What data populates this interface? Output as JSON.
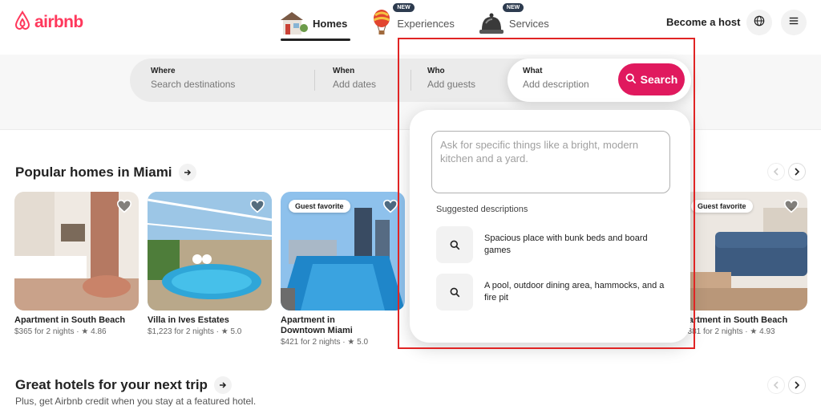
{
  "brand": {
    "name": "airbnb",
    "color": "#ff385c",
    "icon": "airbnb-logo-icon"
  },
  "nav": [
    {
      "label": "Homes",
      "icon": "house-icon",
      "active": true,
      "badge": ""
    },
    {
      "label": "Experiences",
      "icon": "hot-air-balloon-icon",
      "active": false,
      "badge": "NEW"
    },
    {
      "label": "Services",
      "icon": "service-bell-icon",
      "active": false,
      "badge": "NEW"
    }
  ],
  "header": {
    "host_label": "Become a host",
    "globe_icon": "globe-icon",
    "menu_icon": "menu-icon"
  },
  "search": {
    "where": {
      "label": "Where",
      "value": "Search destinations"
    },
    "when": {
      "label": "When",
      "value": "Add dates"
    },
    "who": {
      "label": "Who",
      "value": "Add guests"
    },
    "what": {
      "label": "What",
      "value": "Add description"
    },
    "button_label": "Search",
    "button_color": "#e0195e"
  },
  "dropdown": {
    "placeholder": "Ask for specific things like a bright, modern kitchen and a yard.",
    "suggestions_heading": "Suggested descriptions",
    "suggestions": [
      {
        "text": "Spacious place with bunk beds and board games",
        "icon": "search-icon"
      },
      {
        "text": "A pool, outdoor dining area, hammocks, and a fire pit",
        "icon": "search-icon"
      }
    ]
  },
  "sections": {
    "popular": {
      "title": "Popular homes in Miami"
    },
    "hotels": {
      "title": "Great hotels for your next trip",
      "subtitle": "Plus, get Airbnb credit when you stay at a featured hotel."
    }
  },
  "listings": [
    {
      "title": "Apartment in South Beach",
      "meta": "$365 for 2 nights · ★ 4.86",
      "badge": ""
    },
    {
      "title": "Villa in Ives Estates",
      "meta": "$1,223 for 2 nights · ★ 5.0",
      "badge": ""
    },
    {
      "title": "Apartment in Downtown Miami",
      "meta": "$421 for 2 nights · ★ 5.0",
      "badge": "Guest favorite"
    },
    {
      "title": "partment in South Beach",
      "meta": "$381 for 2 nights · ★ 4.93",
      "badge": "Guest favorite"
    }
  ],
  "colors": {
    "highlight": "#e02424",
    "text": "#222222",
    "muted": "#717171"
  }
}
